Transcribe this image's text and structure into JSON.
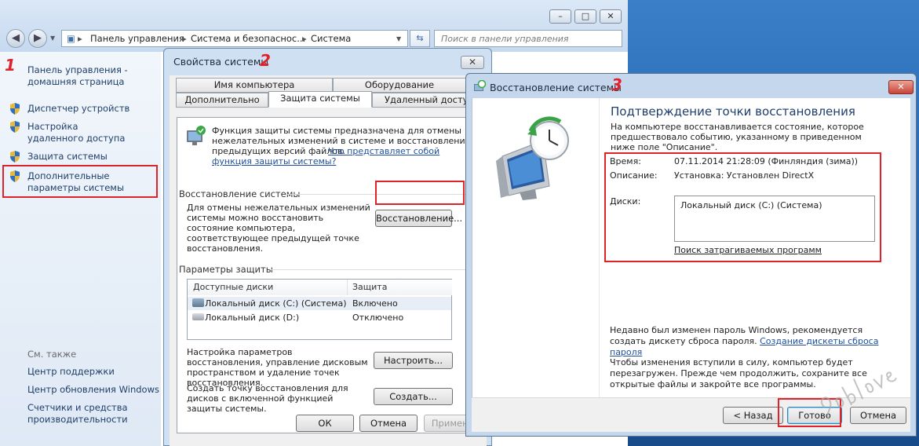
{
  "explorer": {
    "address": [
      "Панель управления",
      "Система и безопаснос...",
      "Система"
    ],
    "search_placeholder": "Поиск в панели управления",
    "caption_buttons": [
      "–",
      "□",
      "✕"
    ]
  },
  "sidebar": {
    "home_link": "Панель управления - домашняя страница",
    "items": [
      {
        "label": "Диспетчер устройств",
        "icon": "shield-icon"
      },
      {
        "label": "Настройка удаленного доступа",
        "icon": "shield-icon"
      },
      {
        "label": "Защита системы",
        "icon": "shield-icon"
      },
      {
        "label": "Дополнительные параметры системы",
        "icon": "shield-icon"
      }
    ],
    "see_also": "См. также",
    "see_also_items": [
      "Центр поддержки",
      "Центр обновления Windows",
      "Счетчики и средства производительности"
    ]
  },
  "annotations": {
    "n1": "1",
    "n2": "2",
    "n3": "3",
    "red": "#e0222b"
  },
  "system_properties": {
    "title": "Свойства системы",
    "tabs_top": [
      "Имя компьютера",
      "Оборудование"
    ],
    "tabs_bottom": [
      "Дополнительно",
      "Защита системы",
      "Удаленный доступ"
    ],
    "intro_text": "Функция защиты системы предназначена для отмены нежелательных изменений в системе и восстановления предыдущих версий файлов.",
    "intro_link": "Что представляет собой функция защиты системы?",
    "restore_group": "Восстановление системы",
    "restore_text": "Для отмены нежелательных изменений системы можно восстановить состояние компьютера, соответствующее предыдущей точке восстановления.",
    "restore_button": "Восстановление...",
    "protection_group": "Параметры защиты",
    "table": {
      "headers": [
        "Доступные диски",
        "Защита"
      ],
      "rows": [
        {
          "disk": "Локальный диск (C:) (Система)",
          "status": "Включено"
        },
        {
          "disk": "Локальный диск (D:)",
          "status": "Отключено"
        }
      ]
    },
    "configure_text": "Настройка параметров восстановления, управление дисковым пространством и удаление точек восстановления.",
    "configure_button": "Настроить...",
    "create_text": "Создать точку восстановления для дисков с включенной функцией защиты системы.",
    "create_button": "Создать...",
    "footer": {
      "ok": "ОК",
      "cancel": "Отмена",
      "apply": "Примени"
    }
  },
  "wizard": {
    "title": "Восстановление системы",
    "heading": "Подтверждение точки восстановления",
    "subtext": "На компьютере восстанавливается состояние, которое предшествовало событию, указанному в приведенном ниже поле \"Описание\".",
    "time_label": "Время:",
    "time_value": "07.11.2014 21:28:09 (Финляндия (зима))",
    "desc_label": "Описание:",
    "desc_value": "Установка: Установлен DirectX",
    "disks_label": "Диски:",
    "disks_value": "Локальный диск (C:) (Система)",
    "scan_link": "Поиск затрагиваемых программ",
    "password_text": "Недавно был изменен пароль Windows, рекомендуется создать дискету сброса пароля.",
    "password_link": "Создание дискеты сброса пароля",
    "restart_text": "Чтобы изменения вступили в силу, компьютер будет перезагружен. Прежде чем продолжить, сохраните все открытые файлы и закройте все программы.",
    "buttons": {
      "back": "< Назад",
      "finish": "Готово",
      "cancel": "Отмена"
    }
  }
}
